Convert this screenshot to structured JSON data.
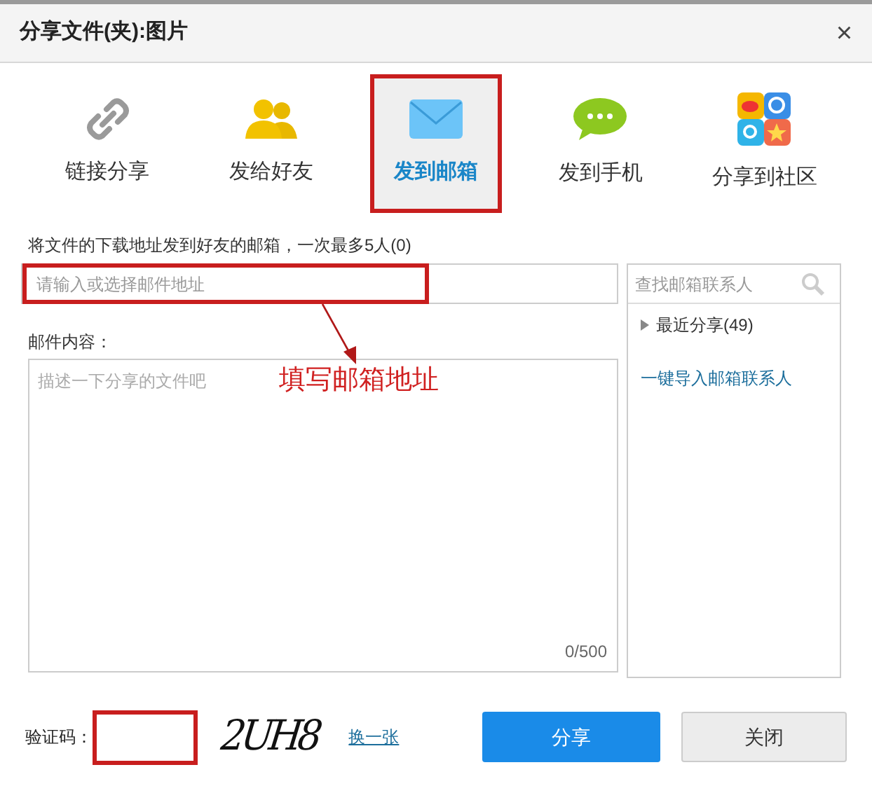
{
  "window": {
    "title": "分享文件(夹):图片",
    "close": "×"
  },
  "tabs": [
    {
      "label": "链接分享",
      "kind": "link",
      "selected": false
    },
    {
      "label": "发给好友",
      "kind": "friends",
      "selected": false
    },
    {
      "label": "发到邮箱",
      "kind": "mail",
      "selected": true
    },
    {
      "label": "发到手机",
      "kind": "phone",
      "selected": false
    },
    {
      "label": "分享到社区",
      "kind": "community",
      "selected": false
    }
  ],
  "hint": "将文件的下载地址发到好友的邮箱，一次最多5人(0)",
  "email_field": {
    "placeholder": "请输入或选择邮件地址"
  },
  "content_label": "邮件内容：",
  "content_field": {
    "placeholder": "描述一下分享的文件吧",
    "counter": "0/500"
  },
  "contacts": {
    "search_placeholder": "查找邮箱联系人",
    "groups": [
      {
        "label": "最近分享(49)",
        "expanded": false
      }
    ],
    "import_link": "一键导入邮箱联系人"
  },
  "annotation": "填写邮箱地址",
  "captcha": {
    "label": "验证码：",
    "code": "2UH8",
    "refresh": "换一张"
  },
  "buttons": [
    {
      "label": "分享",
      "kind": "primary"
    },
    {
      "label": "关闭",
      "kind": "secondary"
    }
  ]
}
